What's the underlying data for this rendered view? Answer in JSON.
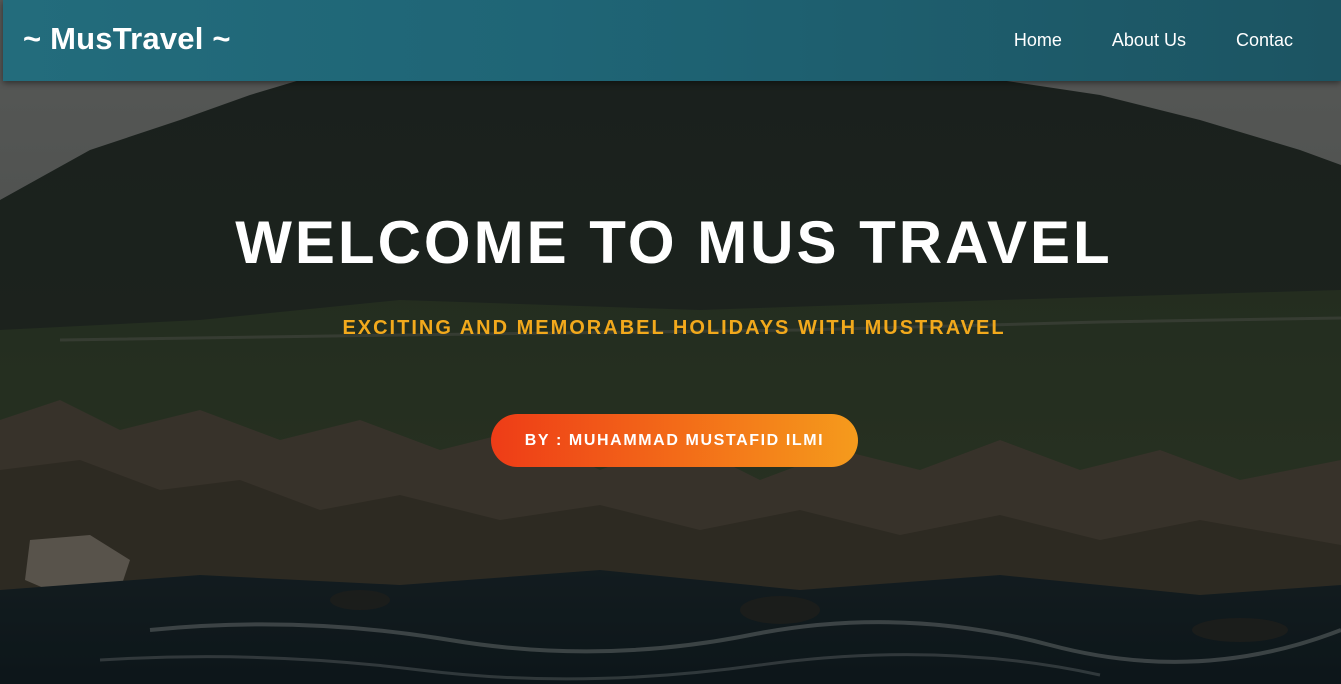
{
  "header": {
    "brand": "~ MusTravel ~",
    "nav": [
      {
        "label": "Home"
      },
      {
        "label": "About Us"
      },
      {
        "label": "Contac"
      }
    ]
  },
  "hero": {
    "title": "WELCOME TO MUS TRAVEL",
    "subtitle": "EXCITING AND MEMORABEL HOLIDAYS WITH MUSTRAVEL",
    "button_label": "BY : MUHAMMAD MUSTAFID ILMI"
  },
  "colors": {
    "navbar": "#1f6576",
    "subtitle": "#f2a91c",
    "button_start": "#ee3c17",
    "button_end": "#f59b1c"
  }
}
